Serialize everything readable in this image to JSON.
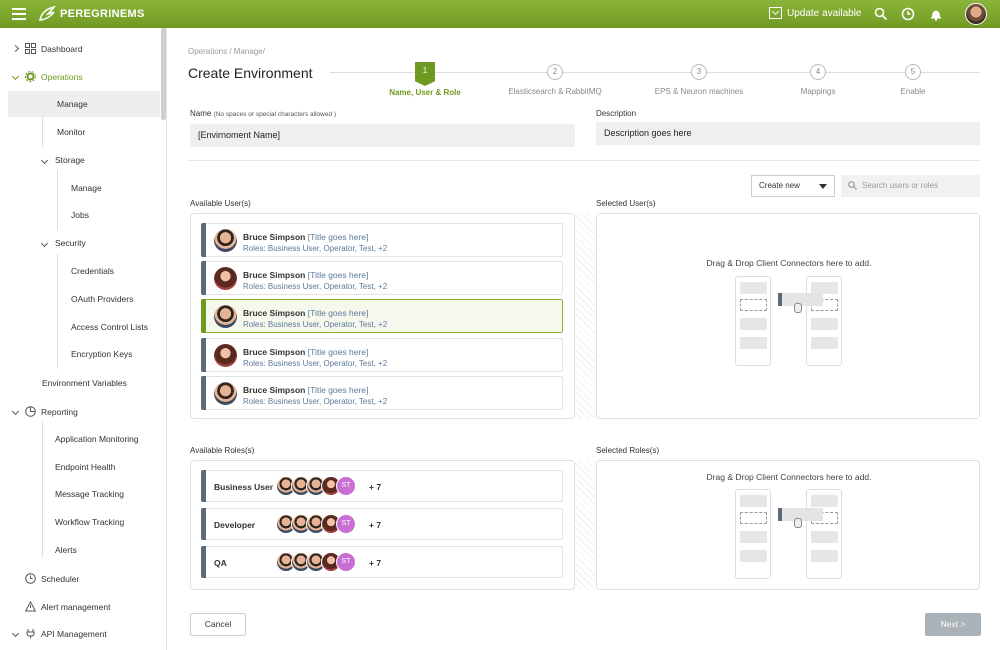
{
  "header": {
    "brand": "PEREGRINEMS",
    "update_label": "Update available"
  },
  "sidebar": {
    "dashboard": "Dashboard",
    "operations": "Operations",
    "manage": "Manage",
    "monitor": "Monitor",
    "storage": "Storage",
    "storage_manage": "Manage",
    "jobs": "Jobs",
    "security": "Security",
    "credentials": "Credentials",
    "oauth": "OAuth Providers",
    "acl": "Access Control Lists",
    "encryption": "Encryption Keys",
    "env_vars": "Environment Variables",
    "reporting": "Reporting",
    "app_monitoring": "Application Monitoring",
    "endpoint_health": "Endpoint Health",
    "message_tracking": "Message Tracking",
    "workflow_tracking": "Workflow Tracking",
    "alerts": "Alerts",
    "scheduler": "Scheduler",
    "alert_management": "Alert management",
    "api_management": "API Management"
  },
  "main": {
    "breadcrumb": "Operations / Manage/",
    "title": "Create Environment",
    "steps": [
      {
        "num": "1",
        "label": "Name, User & Role"
      },
      {
        "num": "2",
        "label": "Elasticsearch & RabbitMQ"
      },
      {
        "num": "3",
        "label": "EPS & Neuron machines"
      },
      {
        "num": "4",
        "label": "Mappings"
      },
      {
        "num": "5",
        "label": "Enable"
      }
    ],
    "name_label": "Name",
    "name_hint": "(No spaces or special characters allowed )",
    "name_value": "[Envirnoment Name]",
    "desc_label": "Description",
    "desc_value": "Description goes here",
    "create_new": "Create new",
    "search_placeholder": "Search users or roles",
    "available_users": "Available User(s)",
    "selected_users": "Selected User(s)",
    "available_roles": "Available Roles(s)",
    "selected_roles": "Selected Roles(s)",
    "dnd_text": "Drag & Drop Client Connectors here to add.",
    "users": [
      {
        "name": "Bruce Simpson",
        "title": "[Title goes here]",
        "roles": "Roles: Business User, Operator, Test, +2"
      },
      {
        "name": "Bruce Simpson",
        "title": "[Title goes here]",
        "roles": "Roles: Business User, Operator, Test, +2"
      },
      {
        "name": "Bruce Simpson",
        "title": "[Title goes here]",
        "roles": "Roles: Business User, Operator, Test, +2"
      },
      {
        "name": "Bruce Simpson",
        "title": "[Title goes here]",
        "roles": "Roles: Business User, Operator, Test, +2"
      },
      {
        "name": "Bruce Simpson",
        "title": "[Title goes here]",
        "roles": "Roles: Business User, Operator, Test, +2"
      }
    ],
    "roles": [
      {
        "name": "Business User",
        "badge": "ST",
        "more": "+ 7"
      },
      {
        "name": "Developer",
        "badge": "ST",
        "more": "+ 7"
      },
      {
        "name": "QA",
        "badge": "ST",
        "more": "+ 7"
      }
    ],
    "cancel": "Cancel",
    "next": "Next >"
  },
  "colors": {
    "accent": "#6f9a22",
    "topbar": "#8cb43a",
    "grip": "#5a6a78",
    "badge": "#c96fd4"
  }
}
